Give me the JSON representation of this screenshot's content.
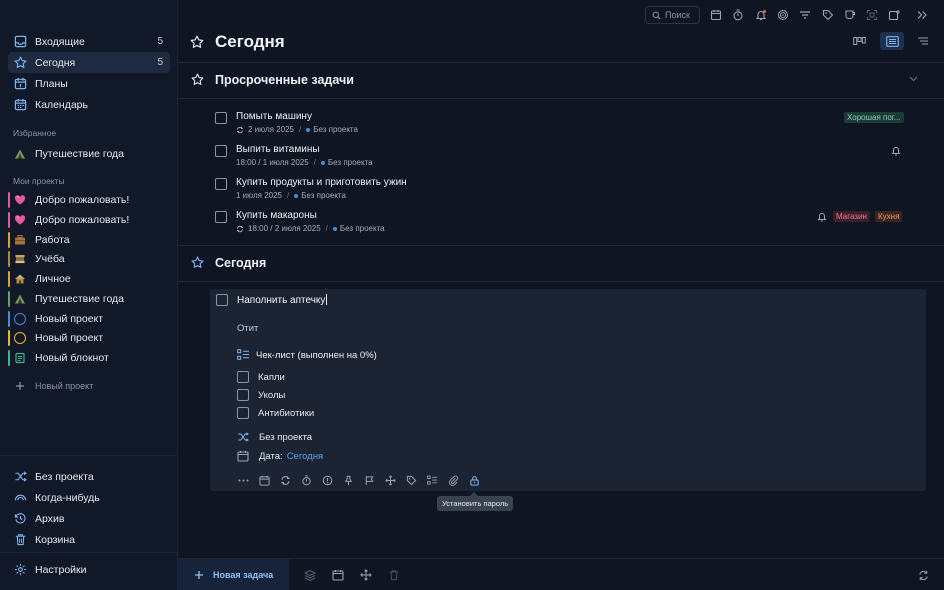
{
  "sidebar": {
    "nav": [
      {
        "label": "Входящие",
        "count": "5"
      },
      {
        "label": "Сегодня",
        "count": "5"
      },
      {
        "label": "Планы"
      },
      {
        "label": "Календарь"
      }
    ],
    "favorites_label": "Избранное",
    "favorites": [
      {
        "label": "Путешествие года",
        "icon": "tent-icon"
      }
    ],
    "projects_label": "Мои проекты",
    "projects": [
      {
        "label": "Добро пожаловать!",
        "icon": "heart-icon",
        "color": "#e25aa5"
      },
      {
        "label": "Добро пожаловать!",
        "icon": "heart-icon",
        "color": "#e25aa5"
      },
      {
        "label": "Работа",
        "icon": "briefcase-icon",
        "color": "#d8a23a"
      },
      {
        "label": "Учёба",
        "icon": "books-icon",
        "color": "#b0893f"
      },
      {
        "label": "Личное",
        "icon": "house-icon",
        "color": "#d8a23a"
      },
      {
        "label": "Путешествие года",
        "icon": "tent-icon",
        "color": "#5aa85a"
      },
      {
        "label": "Новый проект",
        "icon": "circle-icon",
        "color": "#4a8bd6"
      },
      {
        "label": "Новый проект",
        "icon": "circle-icon",
        "color": "#e8b730"
      },
      {
        "label": "Новый блокнот",
        "icon": "notebook-icon",
        "color": "#3db88a"
      }
    ],
    "add_project": "Новый проект",
    "bottom": [
      {
        "label": "Без проекта"
      },
      {
        "label": "Когда-нибудь"
      },
      {
        "label": "Архив"
      },
      {
        "label": "Корзина"
      },
      {
        "label": "Настройки"
      }
    ]
  },
  "topbar": {
    "search_placeholder": "Поиск"
  },
  "page": {
    "title": "Сегодня"
  },
  "overdue": {
    "title": "Просроченные задачи",
    "tasks": [
      {
        "title": "Помыть машину",
        "date": "2 июля 2025",
        "project": "Без проекта",
        "tag": "Хорошая пог..."
      },
      {
        "title": "Выпить витамины",
        "date": "18:00 / 1 июля 2025",
        "project": "Без проекта"
      },
      {
        "title": "Купить продукты и приготовить ужин",
        "date": "1 июля 2025",
        "project": "Без проекта"
      },
      {
        "title": "Купить макароны",
        "date": "18:00 / 2 июля 2025",
        "project": "Без проекта",
        "tags": [
          "Магазин",
          "Кухня"
        ]
      }
    ]
  },
  "today": {
    "title": "Сегодня",
    "card": {
      "title": "Наполнить аптечку",
      "note": "Отит",
      "checklist_label": "Чек-лист (выполнен на 0%)",
      "checklist": [
        "Капли",
        "Уколы",
        "Антибиотики"
      ],
      "project": "Без проекта",
      "date_label": "Дата:",
      "date_value": "Сегодня"
    },
    "tooltip": "Установить пароль"
  },
  "bottombar": {
    "new_task": "Новая задача"
  },
  "colors": {
    "accent": "#5aa2ee",
    "tag_weather": "#7fd0b8",
    "tag_shop": "#f07a8a",
    "tag_kitchen": "#f29a6a"
  }
}
